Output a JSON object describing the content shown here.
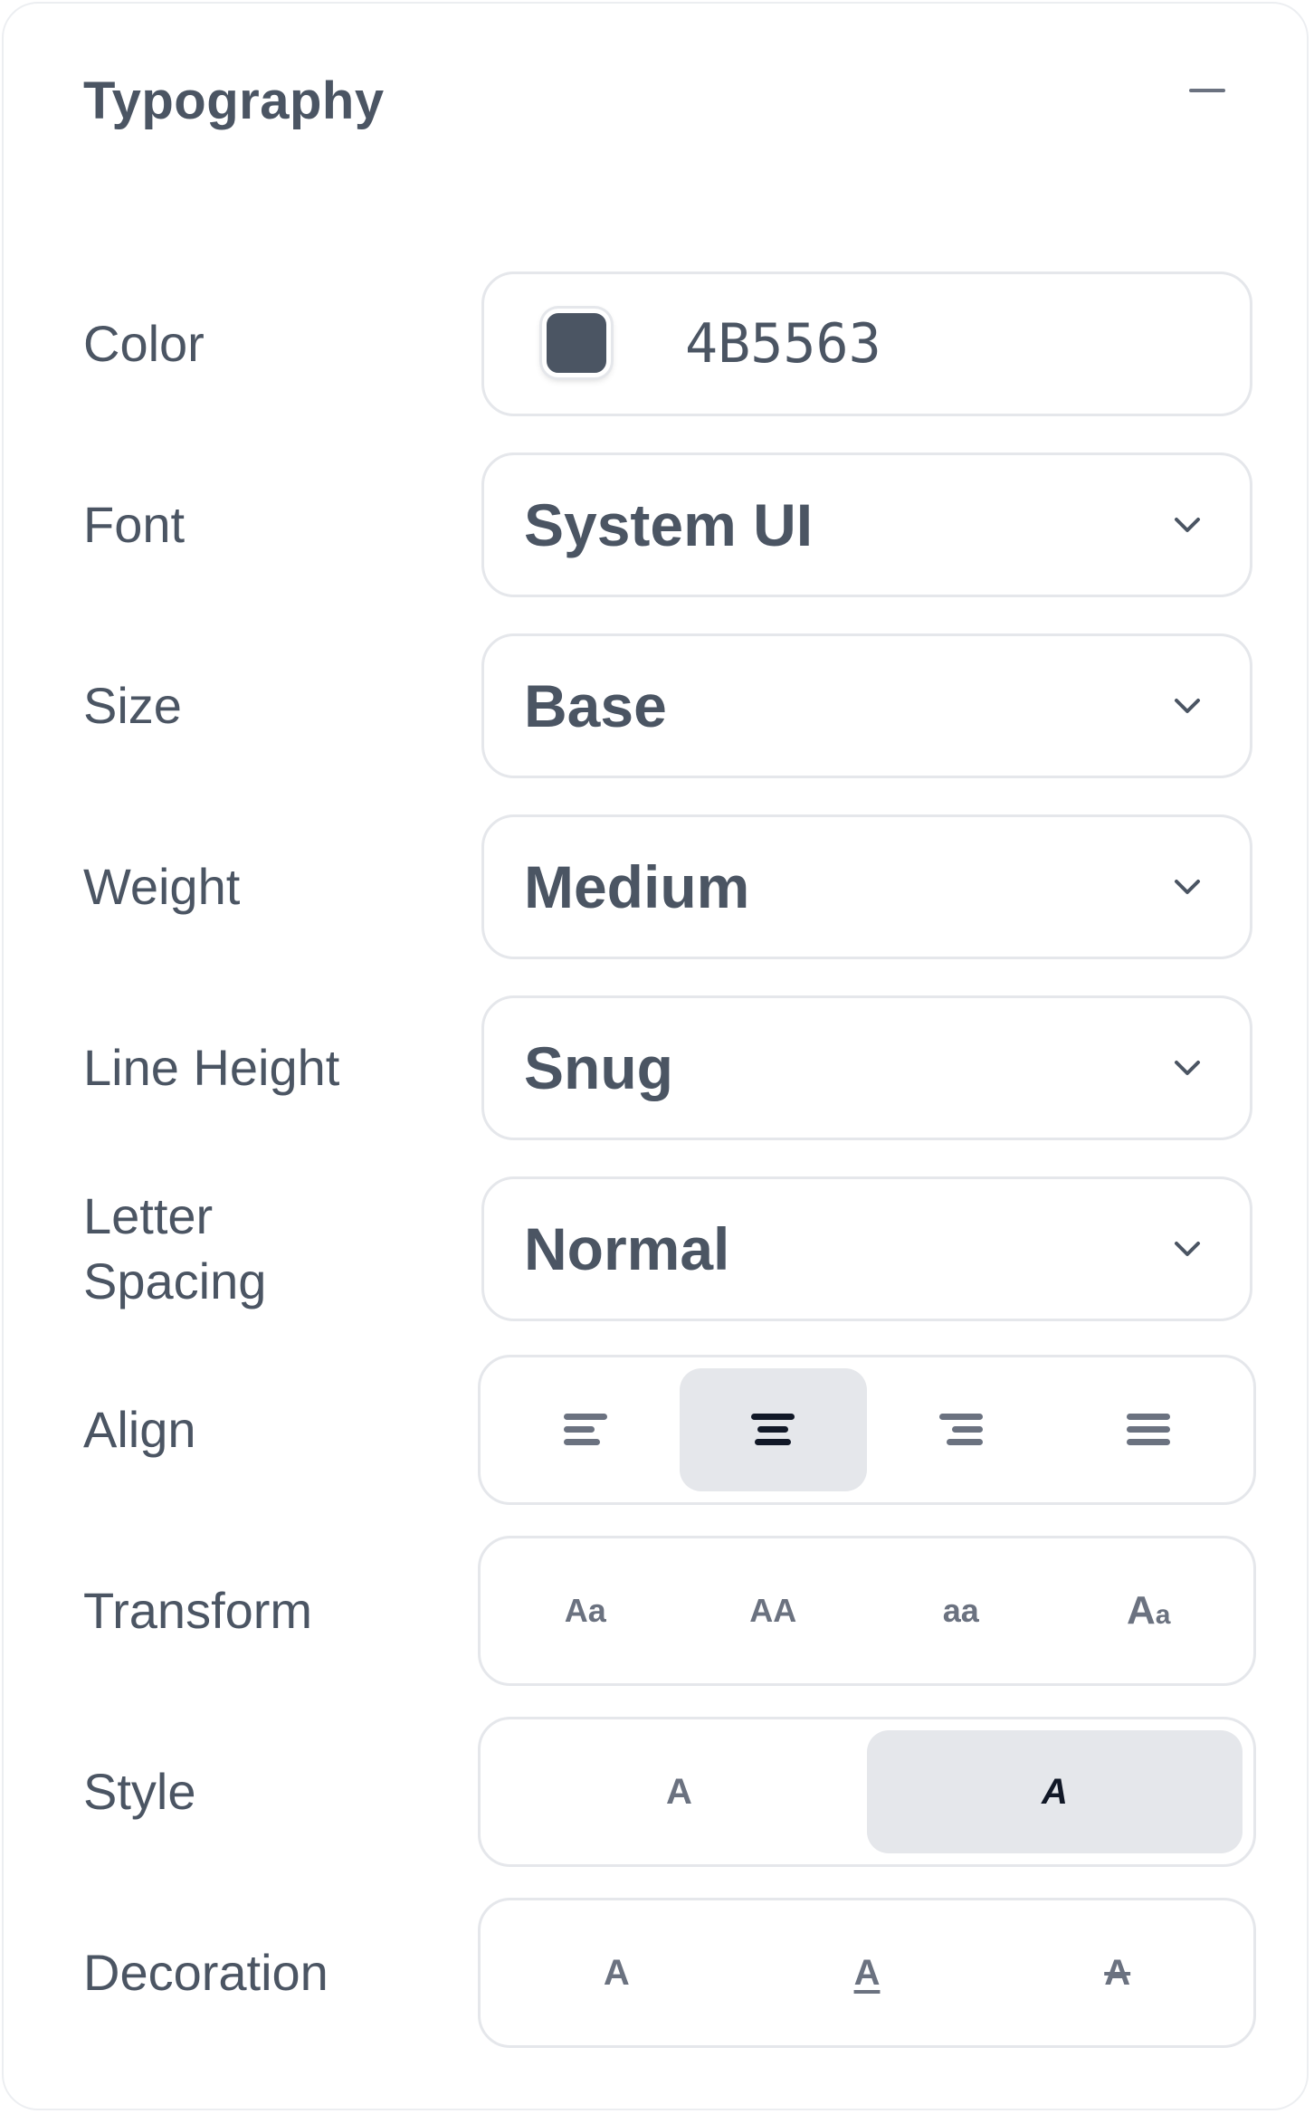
{
  "panel": {
    "title": "Typography",
    "collapse_icon": "minus-icon"
  },
  "color": {
    "label": "Color",
    "hex": "4B5563",
    "swatch": "#4B5563"
  },
  "font": {
    "label": "Font",
    "value": "System UI"
  },
  "size": {
    "label": "Size",
    "value": "Base"
  },
  "weight": {
    "label": "Weight",
    "value": "Medium"
  },
  "line_height": {
    "label": "Line Height",
    "value": "Snug"
  },
  "letter_spacing": {
    "label_line1": "Letter",
    "label_line2": "Spacing",
    "value": "Normal"
  },
  "align": {
    "label": "Align",
    "options": [
      "align-left-icon",
      "align-center-icon",
      "align-right-icon",
      "align-justify-icon"
    ],
    "selected": "center"
  },
  "transform": {
    "label": "Transform",
    "options": [
      "Aa",
      "AA",
      "aa",
      "Aa"
    ]
  },
  "style": {
    "label": "Style",
    "options": [
      "A",
      "A"
    ],
    "selected": "italic"
  },
  "decoration": {
    "label": "Decoration",
    "options": [
      "A",
      "A",
      "A"
    ]
  },
  "colors": {
    "text": "#4B5563",
    "border": "#e5e7eb",
    "active_bg": "#e5e7eb"
  }
}
